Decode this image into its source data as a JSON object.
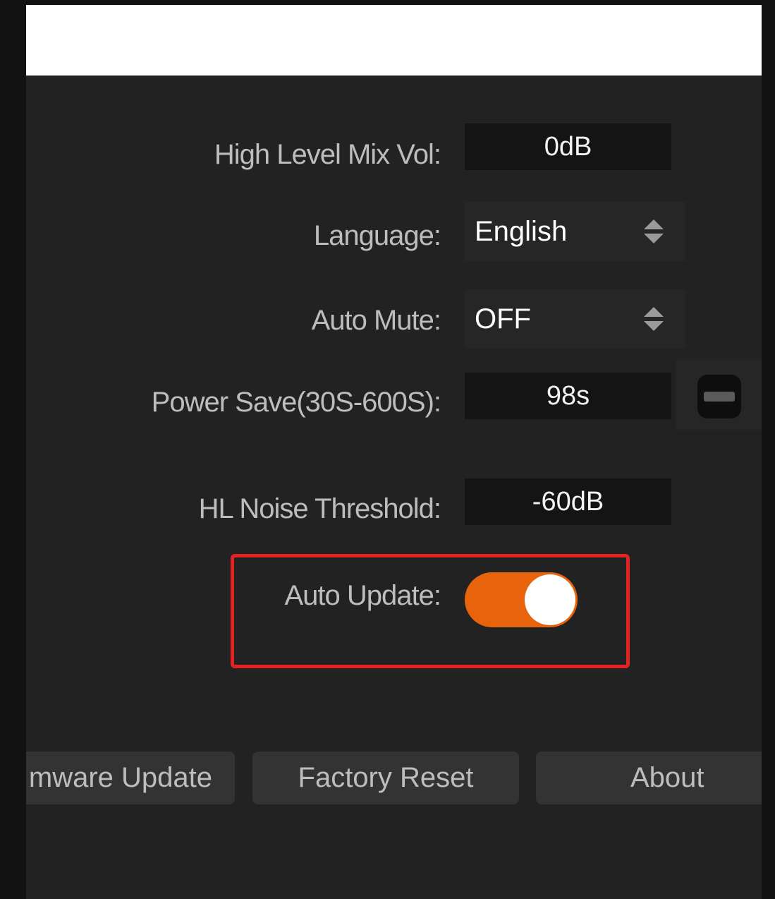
{
  "settings": {
    "high_level_mix_vol": {
      "label": "High Level Mix Vol:",
      "value": "0dB"
    },
    "language": {
      "label": "Language:",
      "value": "English"
    },
    "auto_mute": {
      "label": "Auto Mute:",
      "value": "OFF"
    },
    "power_save": {
      "label": "Power Save(30S-600S):",
      "value": "98s"
    },
    "hl_noise_threshold": {
      "label": "HL Noise Threshold:",
      "value": "-60dB"
    },
    "auto_update": {
      "label": "Auto Update:",
      "enabled": true
    }
  },
  "buttons": {
    "firmware_update": "mware Update",
    "factory_reset": "Factory Reset",
    "about": "About"
  },
  "colors": {
    "toggle_on": "#e8640c",
    "highlight_border": "#e32222",
    "panel_bg": "#222222"
  }
}
